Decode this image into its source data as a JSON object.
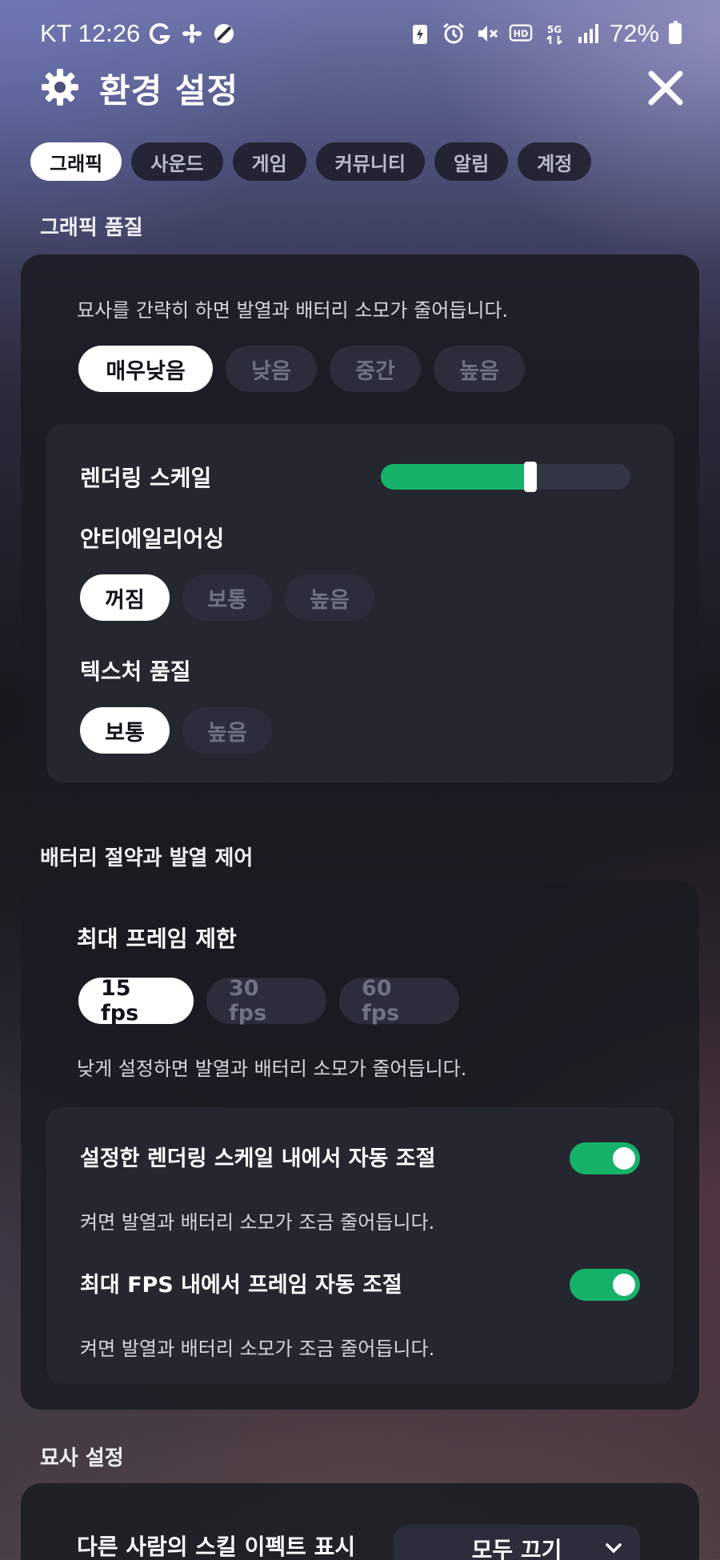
{
  "status_bar": {
    "time": "KT 12:26",
    "battery": "72%"
  },
  "header": {
    "title": "환경 설정"
  },
  "tabs": [
    {
      "label": "그래픽",
      "active": true
    },
    {
      "label": "사운드",
      "active": false
    },
    {
      "label": "게임",
      "active": false
    },
    {
      "label": "커뮤니티",
      "active": false
    },
    {
      "label": "알림",
      "active": false
    },
    {
      "label": "계정",
      "active": false
    }
  ],
  "graphics_quality": {
    "section_title": "그래픽 품질",
    "description": "묘사를 간략히 하면 발열과 배터리 소모가 줄어듭니다.",
    "presets": [
      "매우낮음",
      "낮음",
      "중간",
      "높음"
    ],
    "selected_preset": "매우낮음",
    "rendering_scale_label": "렌더링 스케일",
    "rendering_scale_value": 0.6,
    "antialiasing_label": "안티에일리어싱",
    "antialiasing_options": [
      "꺼짐",
      "보통",
      "높음"
    ],
    "antialiasing_selected": "꺼짐",
    "texture_label": "텍스처 품질",
    "texture_options": [
      "보통",
      "높음"
    ],
    "texture_selected": "보통"
  },
  "battery": {
    "section_title": "배터리 절약과 발열 제어",
    "frame_limit_label": "최대 프레임 제한",
    "fps_options": [
      "15 fps",
      "30 fps",
      "60 fps"
    ],
    "fps_selected": "15 fps",
    "description": "낮게 설정하면 발열과 배터리 소모가 줄어듭니다.",
    "auto_scale_label": "설정한 렌더링 스케일 내에서 자동 조절",
    "auto_scale_desc": "켜면 발열과 배터리 소모가 조금 줄어듭니다.",
    "auto_scale_on": true,
    "auto_frame_label": "최대 FPS 내에서 프레임 자동 조절",
    "auto_frame_desc": "켜면 발열과 배터리 소모가 조금 줄어듭니다.",
    "auto_frame_on": true
  },
  "render_settings": {
    "section_title": "묘사 설정",
    "skill_effect_label": "다른 사람의 스킬 이펙트 표시",
    "skill_effect_value": "모두 끄기"
  },
  "colors": {
    "accent": "#17b26a"
  }
}
